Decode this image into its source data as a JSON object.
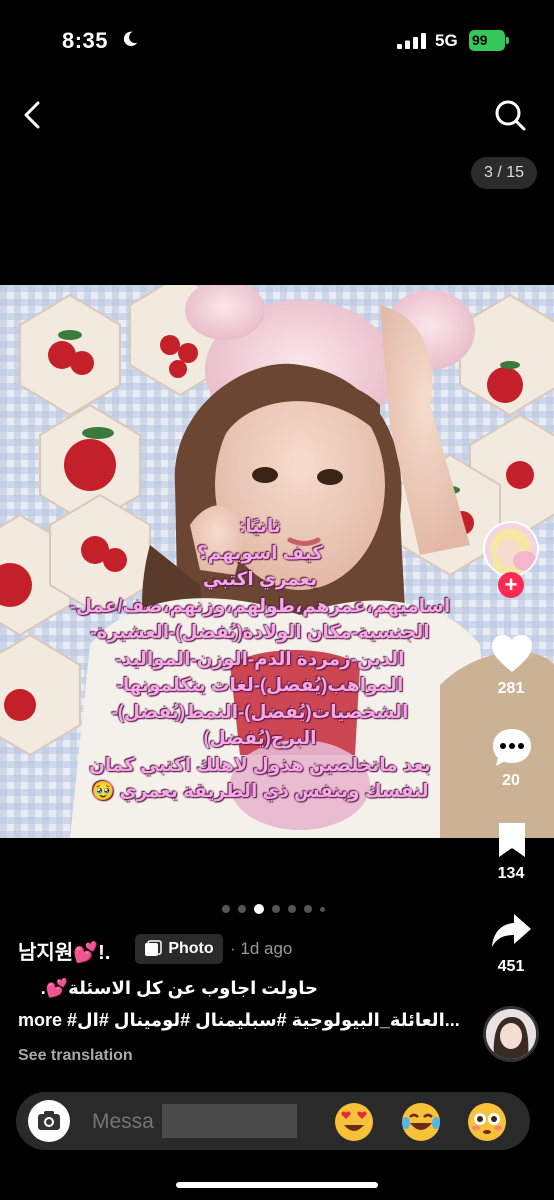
{
  "status": {
    "time": "8:35",
    "network": "5G",
    "battery": "99"
  },
  "nav": {
    "counter": "3 / 15"
  },
  "overlay_lines": [
    "ثانيًا:",
    "كيف اسويهم؟",
    "يعمري اكتبي",
    "اساميهم،عمرهم،طولهم،وزنهم،صف/عمل-",
    "الجنسية-مكان الولادة(يُفضل)-العشيرة-",
    "الدين-زمردة الدم-الوزن-المواليد-",
    "المواهب(يُفضل)-لغات يتكلمونها-",
    "الشخصيات(يُفضل)-النمط(يُفضل)-",
    "البرج(يُفضل)",
    "بعد ماتخلصين هذول لاهلك اكتبي كمان",
    "لنفسك وبنفس ذي الطريقة يعمري 🥹"
  ],
  "rail": {
    "likes": "281",
    "comments": "20",
    "saves": "134",
    "shares": "451"
  },
  "post": {
    "author": "남지원💕!.",
    "type_label": "Photo",
    "date": "· 1d ago",
    "caption": "حاولت اجاوب عن كل الاسئلة💕.",
    "hashtags": "#العائلة_البيولوجية #سبليمنال #لومينال #ال...",
    "more": "more",
    "see_translation": "See translation"
  },
  "comment": {
    "placeholder": "Messa",
    "emojis": [
      "😍",
      "😂",
      "😳"
    ]
  },
  "colors": {
    "accent": "#fe2c55",
    "overlay_text": "#f4a9e4",
    "battery": "#34c759"
  }
}
